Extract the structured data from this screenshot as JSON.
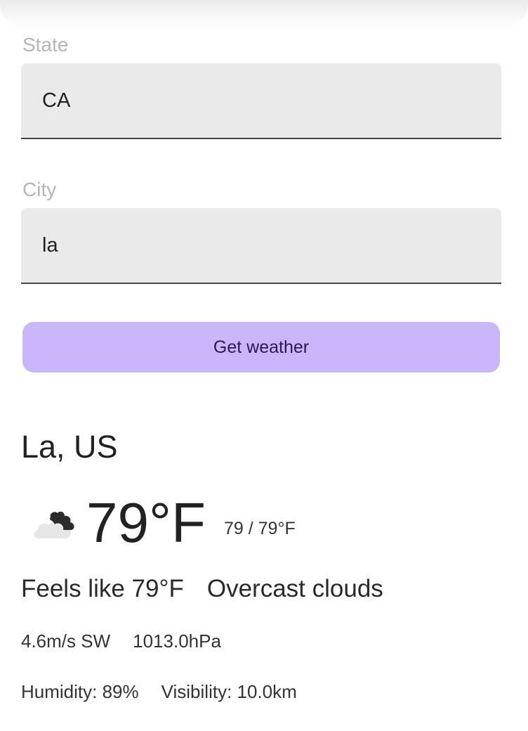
{
  "form": {
    "state_label": "State",
    "state_value": "CA",
    "city_label": "City",
    "city_value": "la",
    "submit_label": "Get weather"
  },
  "weather": {
    "location": "La, US",
    "icon": "overcast-cloud-icon",
    "temperature": "79°F",
    "min_max": "79 / 79°F",
    "feels_like": "Feels like 79°F",
    "description": "Overcast clouds",
    "wind": "4.6m/s SW",
    "pressure": "1013.0hPa",
    "humidity": "Humidity: 89%",
    "visibility": "Visibility: 10.0km"
  },
  "colors": {
    "button_bg": "#c9b6fb",
    "field_bg": "#eaeaea",
    "label": "#b5b5b5"
  }
}
